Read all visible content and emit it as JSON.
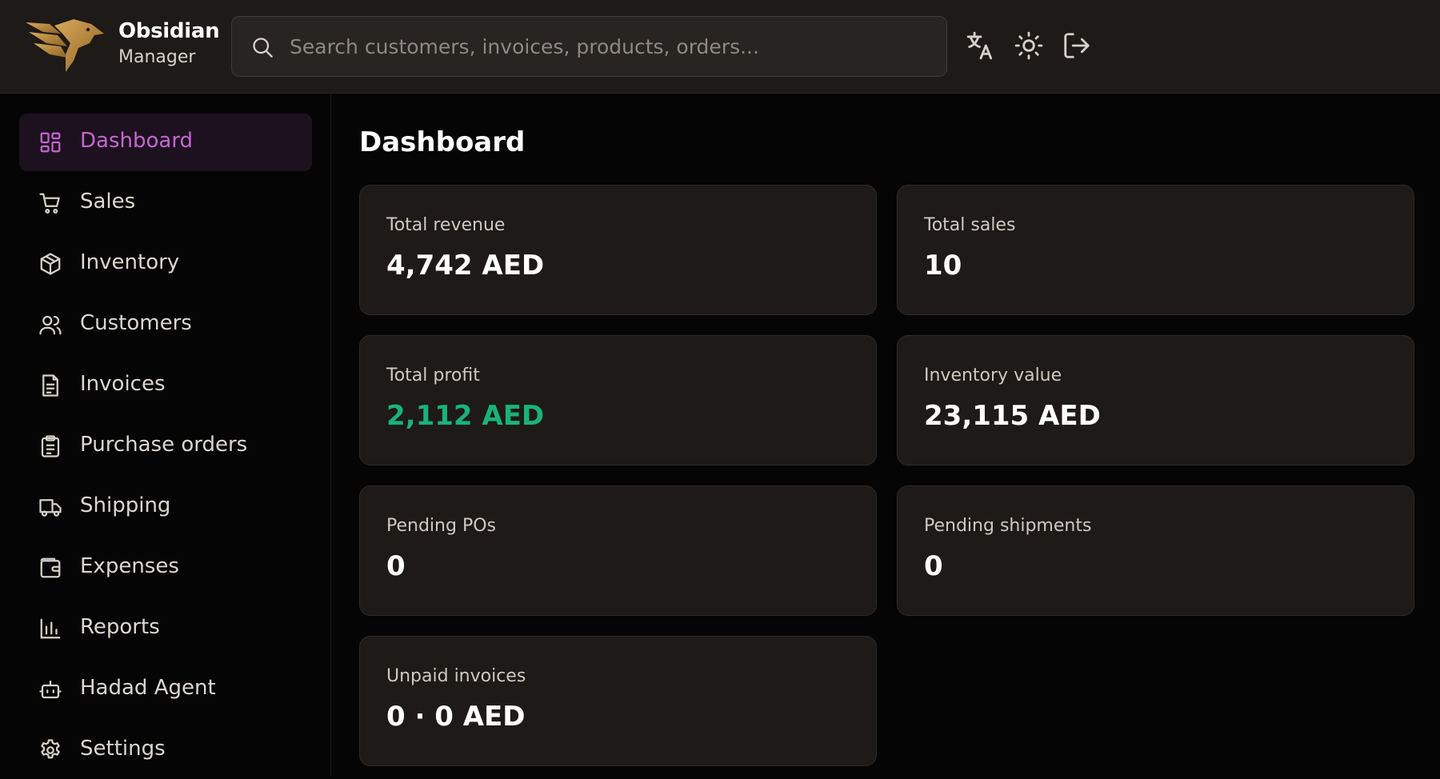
{
  "app": {
    "brand_name": "Obsidian",
    "brand_sub": "Manager"
  },
  "search": {
    "placeholder": "Search customers, invoices, products, orders..."
  },
  "header_icons": [
    "translate-icon",
    "sun-icon",
    "logout-icon"
  ],
  "sidebar": {
    "items": [
      {
        "label": "Dashboard",
        "icon": "dashboard-icon",
        "active": true
      },
      {
        "label": "Sales",
        "icon": "cart-icon"
      },
      {
        "label": "Inventory",
        "icon": "box-icon"
      },
      {
        "label": "Customers",
        "icon": "users-icon"
      },
      {
        "label": "Invoices",
        "icon": "document-icon"
      },
      {
        "label": "Purchase orders",
        "icon": "clipboard-icon"
      },
      {
        "label": "Shipping",
        "icon": "truck-icon"
      },
      {
        "label": "Expenses",
        "icon": "wallet-icon"
      },
      {
        "label": "Reports",
        "icon": "bar-chart-icon"
      },
      {
        "label": "Hadad Agent",
        "icon": "bot-icon"
      },
      {
        "label": "Settings",
        "icon": "gear-icon"
      }
    ]
  },
  "main": {
    "title": "Dashboard",
    "cards": [
      {
        "label": "Total revenue",
        "value": "4,742 AED"
      },
      {
        "label": "Total sales",
        "value": "10"
      },
      {
        "label": "Total profit",
        "value": "2,112 AED"
      },
      {
        "label": "Inventory value",
        "value": "23,115 AED"
      },
      {
        "label": "Pending POs",
        "value": "0"
      },
      {
        "label": "Pending shipments",
        "value": "0"
      },
      {
        "label": "Unpaid invoices",
        "value": "0 · 0 AED"
      }
    ]
  },
  "colors": {
    "accent": "#c267cf",
    "profit": "#1bb27a",
    "logo_gold": "#b8863d"
  }
}
